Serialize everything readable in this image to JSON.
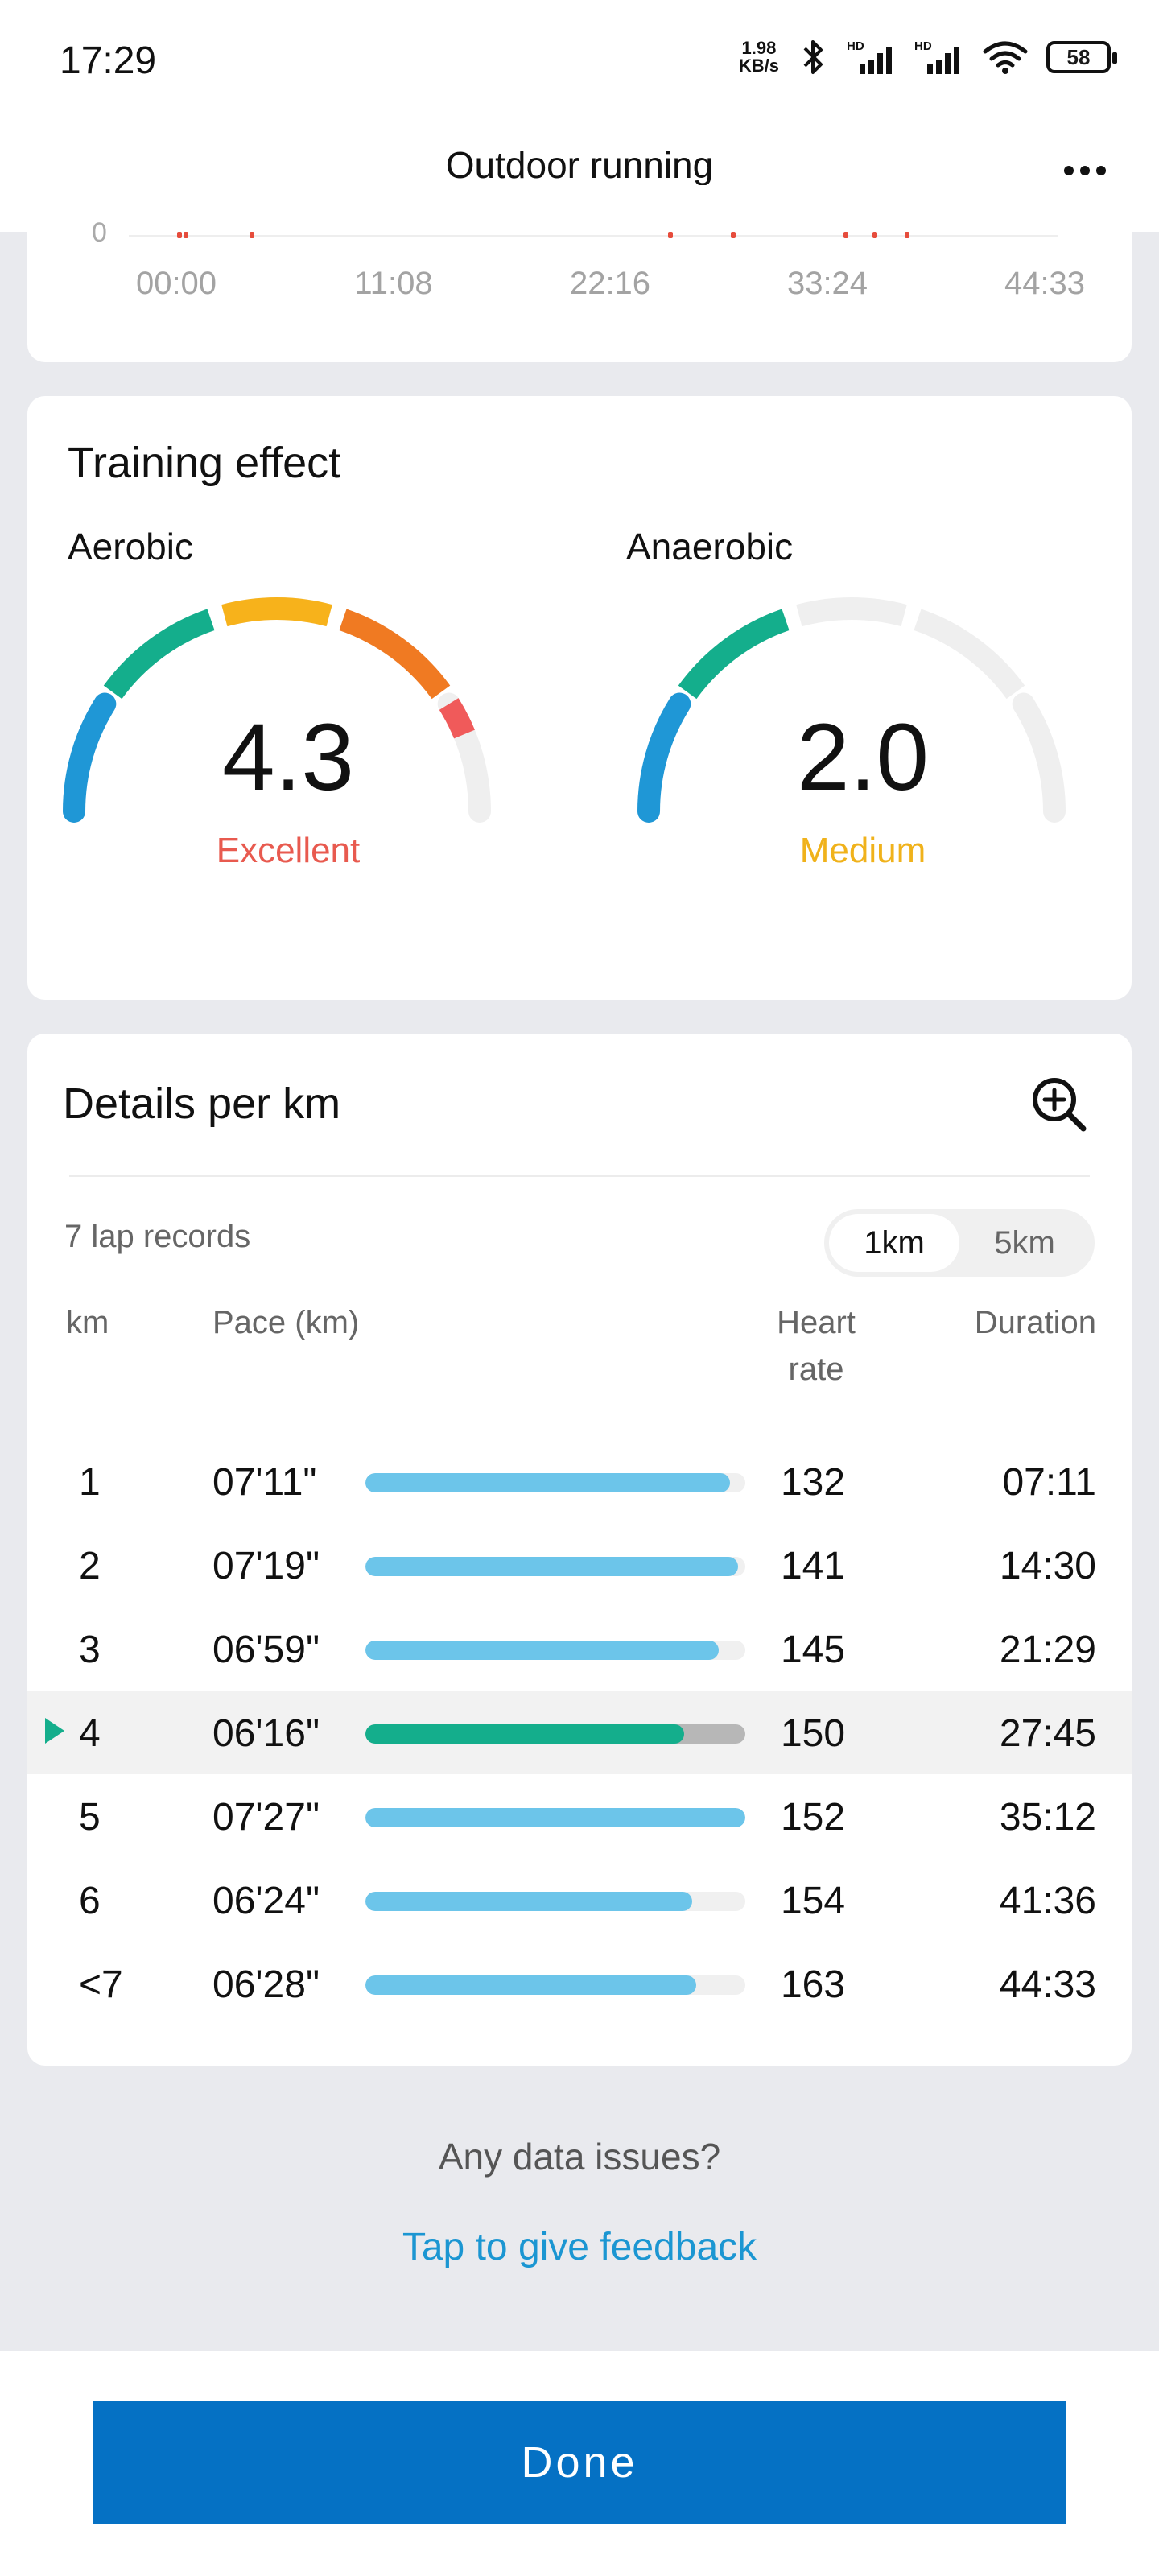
{
  "status_bar": {
    "time": "17:29",
    "net_speed_value": "1.98",
    "net_speed_unit": "KB/s",
    "battery": "58",
    "icons": [
      "bluetooth-icon",
      "signal-hd-icon",
      "signal-hd-icon",
      "wifi-icon",
      "battery-icon"
    ]
  },
  "header": {
    "title": "Outdoor running",
    "more_icon": "more-horizontal-icon"
  },
  "hr_chart": {
    "zero_label": "0",
    "ticks": [
      "00:00",
      "11:08",
      "22:16",
      "33:24",
      "44:33"
    ]
  },
  "training": {
    "title": "Training effect",
    "aerobic": {
      "label": "Aerobic",
      "value": "4.3",
      "status": "Excellent",
      "status_color": "#e85a4f",
      "level": 4.3
    },
    "anaerobic": {
      "label": "Anaerobic",
      "value": "2.0",
      "status": "Medium",
      "status_color": "#f0b21b",
      "level": 2.0
    },
    "segment_colors": [
      "#1f97d6",
      "#14ae8c",
      "#f7b21b",
      "#f07a22",
      "#f05a5a"
    ]
  },
  "details": {
    "title": "Details per km",
    "zoom_icon": "zoom-in-icon",
    "lap_count": "7 lap records",
    "unit_options": [
      "1km",
      "5km"
    ],
    "selected_unit": "1km",
    "columns": {
      "km": "km",
      "pace": "Pace (km)",
      "heart_rate_1": "Heart",
      "heart_rate_2": "rate",
      "duration": "Duration"
    },
    "rows": [
      {
        "km": "1",
        "pace": "07'11\"",
        "hr": "132",
        "duration": "07:11",
        "pace_fraction": 0.96
      },
      {
        "km": "2",
        "pace": "07'19\"",
        "hr": "141",
        "duration": "14:30",
        "pace_fraction": 0.98
      },
      {
        "km": "3",
        "pace": "06'59\"",
        "hr": "145",
        "duration": "21:29",
        "pace_fraction": 0.93
      },
      {
        "km": "4",
        "pace": "06'16\"",
        "hr": "150",
        "duration": "27:45",
        "pace_fraction": 0.84
      },
      {
        "km": "5",
        "pace": "07'27\"",
        "hr": "152",
        "duration": "35:12",
        "pace_fraction": 1.0
      },
      {
        "km": "6",
        "pace": "06'24\"",
        "hr": "154",
        "duration": "41:36",
        "pace_fraction": 0.86
      },
      {
        "km": "<7",
        "pace": "06'28\"",
        "hr": "163",
        "duration": "44:33",
        "pace_fraction": 0.87
      }
    ],
    "highlighted_index": 3
  },
  "feedback": {
    "question": "Any data issues?",
    "link": "Tap to give feedback"
  },
  "footer": {
    "done_label": "Done"
  }
}
